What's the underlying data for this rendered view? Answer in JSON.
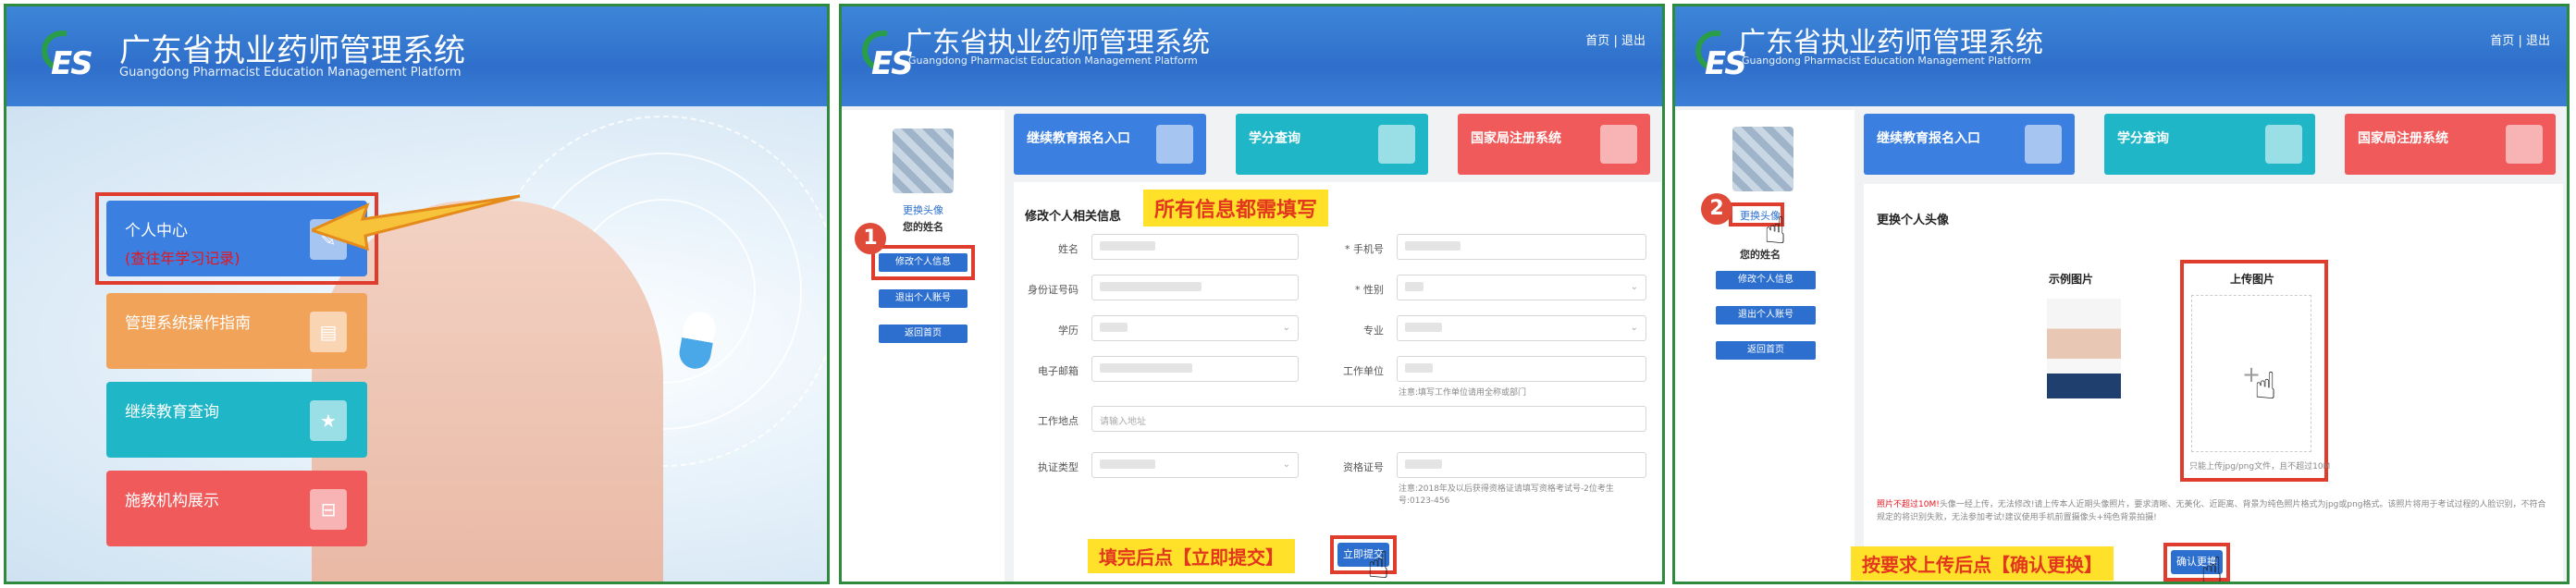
{
  "header": {
    "title": "广东省执业药师管理系统",
    "subtitle": "Guangdong Pharmacist Education Management Platform",
    "logo": "ES",
    "home_link": "首页",
    "sep": "|",
    "logout_link": "退出"
  },
  "panel1": {
    "menu": [
      {
        "label": "个人中心",
        "sub": "(查往年学习记录)",
        "color": "#3b7fe0",
        "icon": "edit-icon"
      },
      {
        "label": "管理系统操作指南",
        "color": "#f2a35a",
        "icon": "book-icon"
      },
      {
        "label": "继续教育查询",
        "color": "#1fb7c8",
        "icon": "star-icon"
      },
      {
        "label": "施教机构展示",
        "color": "#f05a5a",
        "icon": "org-icon"
      }
    ]
  },
  "sidebar": {
    "change_avatar": "更换头像",
    "your_name": "您的姓名",
    "edit_info": "修改个人信息",
    "logout_account": "退出个人账号",
    "back_home": "返回首页"
  },
  "cards": [
    {
      "label": "继续教育报名入口",
      "color": "#3b7fe0"
    },
    {
      "label": "学分查询",
      "color": "#1fb7c8"
    },
    {
      "label": "国家局注册系统",
      "color": "#f05a5a"
    }
  ],
  "panel2": {
    "step": "1",
    "section_title": "修改个人相关信息",
    "callout_top": "所有信息都需填写",
    "callout_bottom": "填完后点【立即提交】",
    "submit_label": "立即提交",
    "fields": {
      "name": "姓名",
      "phone": "* 手机号",
      "idno": "身份证号码",
      "gender": "* 性别",
      "edu": "学历",
      "major": "专业",
      "email": "电子邮箱",
      "work": "工作单位",
      "work_tip": "注意:填写工作单位请用全称或部门",
      "addr": "工作地点",
      "addr_ph": "请输入地址",
      "cert_type": "执证类型",
      "cert_no": "资格证号",
      "cert_tip": "注意:2018年及以后获得资格证请填写资格考试号-2位考生号:0123-456"
    }
  },
  "panel3": {
    "step": "2",
    "title": "更换个人头像",
    "example": "示例图片",
    "upload": "上传图片",
    "plus": "+",
    "upload_tip": "只能上传jpg/png文件，且不超过10M",
    "note_red": "照片不超过10M!",
    "note": "头像一经上传，无法修改!请上传本人近期头像照片，要求清晰、无美化、近距离、背景为纯色照片格式为jpg或png格式。该照片将用于考试过程的人脸识别，不符合规定的将识别失败，无法参加考试!建议使用手机前置摄像头+纯色背景拍摄!",
    "callout": "按要求上传后点【确认更换】",
    "confirm_label": "确认更换"
  }
}
